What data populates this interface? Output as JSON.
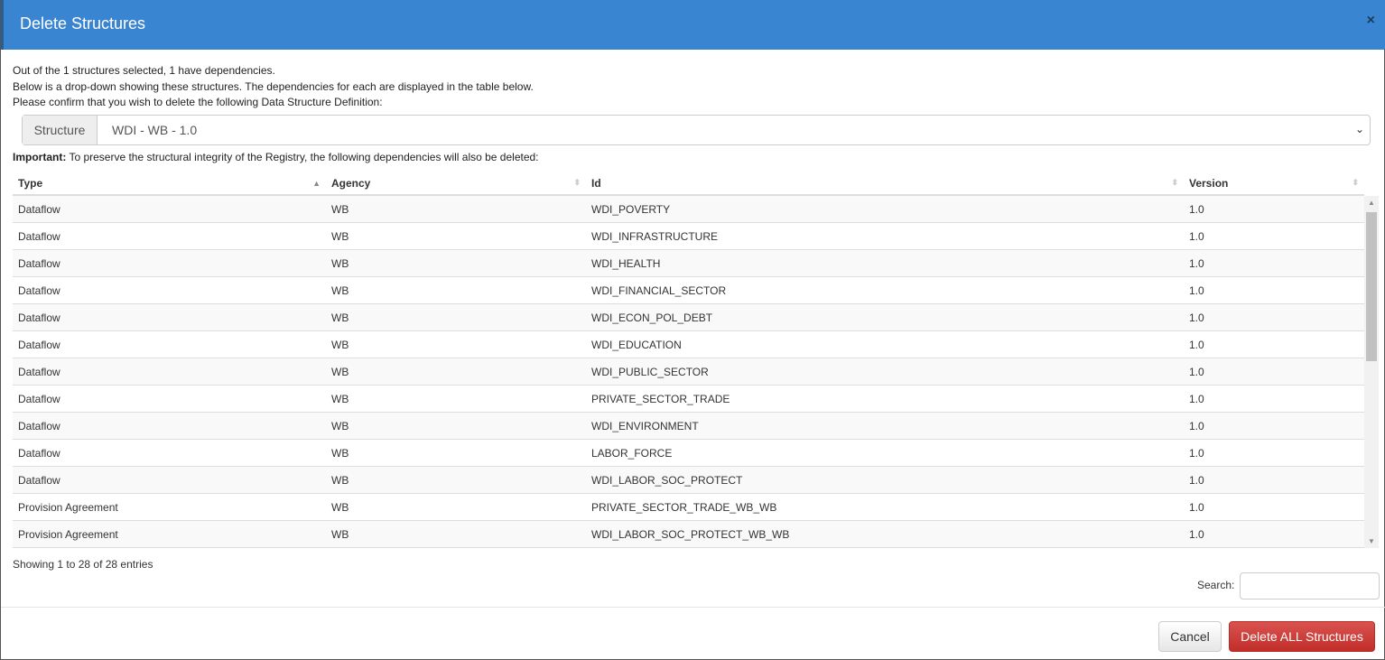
{
  "dialog": {
    "title": "Delete Structures",
    "close": "×"
  },
  "messages": [
    "Out of the 1 structures selected, 1 have dependencies.",
    "Below is a drop-down showing these structures. The dependencies for each are displayed in the table below.",
    "Please confirm that you wish to delete the following Data Structure Definition:"
  ],
  "structure": {
    "label": "Structure",
    "value": "WDI - WB - 1.0"
  },
  "important": {
    "bold": "Important:",
    "text": " To preserve the structural integrity of the Registry, the following dependencies will also be deleted:"
  },
  "table": {
    "headers": [
      "Type",
      "Agency",
      "Id",
      "Version"
    ],
    "rows": [
      [
        "Dataflow",
        "WB",
        "WDI_POVERTY",
        "1.0"
      ],
      [
        "Dataflow",
        "WB",
        "WDI_INFRASTRUCTURE",
        "1.0"
      ],
      [
        "Dataflow",
        "WB",
        "WDI_HEALTH",
        "1.0"
      ],
      [
        "Dataflow",
        "WB",
        "WDI_FINANCIAL_SECTOR",
        "1.0"
      ],
      [
        "Dataflow",
        "WB",
        "WDI_ECON_POL_DEBT",
        "1.0"
      ],
      [
        "Dataflow",
        "WB",
        "WDI_EDUCATION",
        "1.0"
      ],
      [
        "Dataflow",
        "WB",
        "WDI_PUBLIC_SECTOR",
        "1.0"
      ],
      [
        "Dataflow",
        "WB",
        "PRIVATE_SECTOR_TRADE",
        "1.0"
      ],
      [
        "Dataflow",
        "WB",
        "WDI_ENVIRONMENT",
        "1.0"
      ],
      [
        "Dataflow",
        "WB",
        "LABOR_FORCE",
        "1.0"
      ],
      [
        "Dataflow",
        "WB",
        "WDI_LABOR_SOC_PROTECT",
        "1.0"
      ],
      [
        "Provision Agreement",
        "WB",
        "PRIVATE_SECTOR_TRADE_WB_WB",
        "1.0"
      ],
      [
        "Provision Agreement",
        "WB",
        "WDI_LABOR_SOC_PROTECT_WB_WB",
        "1.0"
      ]
    ],
    "info": "Showing 1 to 28 of 28 entries",
    "search_label": "Search:",
    "search_value": ""
  },
  "buttons": {
    "cancel": "Cancel",
    "delete": "Delete ALL Structures"
  }
}
